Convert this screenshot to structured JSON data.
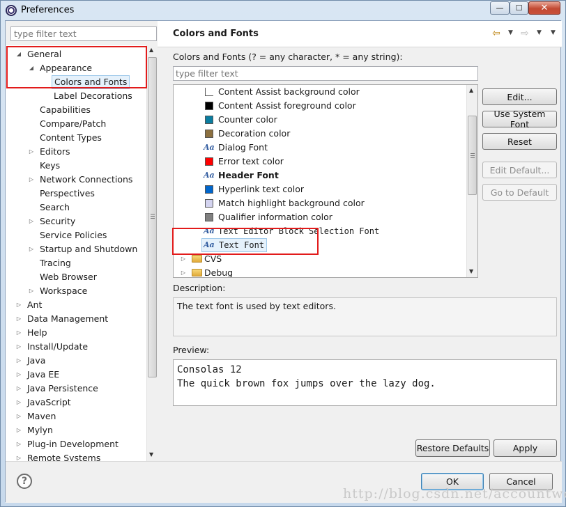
{
  "window": {
    "title": "Preferences",
    "min_label": "—",
    "max_label": "☐",
    "close_label": "✕"
  },
  "left": {
    "filter_placeholder": "type filter text",
    "tree": [
      {
        "label": "General",
        "level": 0,
        "twisty": "open"
      },
      {
        "label": "Appearance",
        "level": 1,
        "twisty": "open"
      },
      {
        "label": "Colors and Fonts",
        "level": 2,
        "twisty": "none",
        "selected": true
      },
      {
        "label": "Label Decorations",
        "level": 2,
        "twisty": "none"
      },
      {
        "label": "Capabilities",
        "level": 1,
        "twisty": "none"
      },
      {
        "label": "Compare/Patch",
        "level": 1,
        "twisty": "none"
      },
      {
        "label": "Content Types",
        "level": 1,
        "twisty": "none"
      },
      {
        "label": "Editors",
        "level": 1,
        "twisty": "closed"
      },
      {
        "label": "Keys",
        "level": 1,
        "twisty": "none"
      },
      {
        "label": "Network Connections",
        "level": 1,
        "twisty": "closed"
      },
      {
        "label": "Perspectives",
        "level": 1,
        "twisty": "none"
      },
      {
        "label": "Search",
        "level": 1,
        "twisty": "none"
      },
      {
        "label": "Security",
        "level": 1,
        "twisty": "closed"
      },
      {
        "label": "Service Policies",
        "level": 1,
        "twisty": "none"
      },
      {
        "label": "Startup and Shutdown",
        "level": 1,
        "twisty": "closed"
      },
      {
        "label": "Tracing",
        "level": 1,
        "twisty": "none"
      },
      {
        "label": "Web Browser",
        "level": 1,
        "twisty": "none"
      },
      {
        "label": "Workspace",
        "level": 1,
        "twisty": "closed"
      },
      {
        "label": "Ant",
        "level": 0,
        "twisty": "closed"
      },
      {
        "label": "Data Management",
        "level": 0,
        "twisty": "closed"
      },
      {
        "label": "Help",
        "level": 0,
        "twisty": "closed"
      },
      {
        "label": "Install/Update",
        "level": 0,
        "twisty": "closed"
      },
      {
        "label": "Java",
        "level": 0,
        "twisty": "closed"
      },
      {
        "label": "Java EE",
        "level": 0,
        "twisty": "closed"
      },
      {
        "label": "Java Persistence",
        "level": 0,
        "twisty": "closed"
      },
      {
        "label": "JavaScript",
        "level": 0,
        "twisty": "closed"
      },
      {
        "label": "Maven",
        "level": 0,
        "twisty": "closed"
      },
      {
        "label": "Mylyn",
        "level": 0,
        "twisty": "closed"
      },
      {
        "label": "Plug-in Development",
        "level": 0,
        "twisty": "closed"
      },
      {
        "label": "Remote Systems",
        "level": 0,
        "twisty": "closed"
      }
    ]
  },
  "page": {
    "title": "Colors and Fonts",
    "back_icon": "⇦",
    "forward_icon": "⇨",
    "dropdown_icon": "▼",
    "section_label": "Colors and Fonts (? = any character, * = any string):",
    "filter_placeholder": "type filter text",
    "items": [
      {
        "label": "Content Assist background color",
        "kind": "color",
        "color": "#ffffff"
      },
      {
        "label": "Content Assist foreground color",
        "kind": "color",
        "color": "#000000"
      },
      {
        "label": "Counter color",
        "kind": "color",
        "color": "#0a7da0"
      },
      {
        "label": "Decoration color",
        "kind": "color",
        "color": "#8c7040"
      },
      {
        "label": "Dialog Font",
        "kind": "font"
      },
      {
        "label": "Error text color",
        "kind": "color",
        "color": "#ff0000"
      },
      {
        "label": "Header Font",
        "kind": "font",
        "bold": true
      },
      {
        "label": "Hyperlink text color",
        "kind": "color",
        "color": "#0066cc"
      },
      {
        "label": "Match highlight background color",
        "kind": "color",
        "color": "#d4d4f0"
      },
      {
        "label": "Qualifier information color",
        "kind": "color",
        "color": "#808080"
      },
      {
        "label": "Text Editor Block Selection Font",
        "kind": "font",
        "mono": true
      },
      {
        "label": "Text Font",
        "kind": "font",
        "mono": true,
        "selected": true
      },
      {
        "label": "CVS",
        "kind": "category"
      },
      {
        "label": "Debug",
        "kind": "category"
      }
    ],
    "buttons": {
      "edit": "Edit...",
      "use_system_font": "Use System Font",
      "reset": "Reset",
      "edit_default": "Edit Default...",
      "go_to_default": "Go to Default"
    },
    "description_label": "Description:",
    "description_text": "The text font is used by text editors.",
    "preview_label": "Preview:",
    "preview_lines": [
      "Consolas 12",
      "The quick brown fox jumps over the lazy dog."
    ],
    "restore_defaults": "Restore Defaults",
    "apply": "Apply"
  },
  "footer": {
    "help_symbol": "?",
    "ok": "OK",
    "cancel": "Cancel",
    "watermark": "http://blog.csdn.net/accountwcx"
  },
  "colors": {
    "highlight": "#e21b1b",
    "selection_bg": "#e5f1fb",
    "selection_border": "#9fc9ea"
  }
}
